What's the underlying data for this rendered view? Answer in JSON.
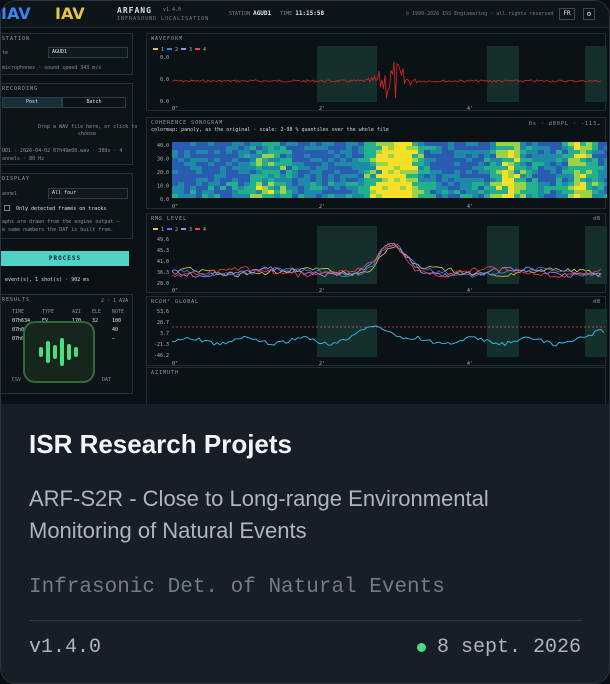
{
  "colors": {
    "accent": "#4fd1c5",
    "status_dot": "#4ade80",
    "card_bg": "#171e27"
  },
  "preview": {
    "logo_left": "IAV",
    "logo_right": "IAV",
    "app_name": "ARFANG",
    "app_version": "v1.4.0",
    "app_subtitle": "INFRASOUND LOCALISATION",
    "station_label": "STATION",
    "station_value": "AGUD1",
    "time_label": "TIME",
    "time_value": "11:15:58",
    "copyright": "© 1999-2026 ISS Engineering · all rights reserved",
    "lang": "FR",
    "left_panel": {
      "station_title": "STATION",
      "site_label": "te",
      "site_value": "AGUD1",
      "site_info": "microphones · sound speed 343 m/s",
      "recording_title": "RECORDING",
      "tab_post": "Post",
      "tab_batch": "Batch",
      "drop_text_1": "Drop a WAV file here, or click to",
      "drop_text_2": "choose",
      "file_info": "UD1 - 2026-04-02 07h49m00.wav · 308s · 4",
      "file_info_2": "annels · 80 Hz",
      "display_title": "DISPLAY",
      "channel_label": "annel",
      "channel_value": "All four",
      "only_detected": "Only detected frames on tracks",
      "display_note_1": "aphs are drawn from the engine output —",
      "display_note_2": "e same numbers the DAT is built from.",
      "process_label": "PROCESS",
      "process_result": "event(s), 1 shot(s) · 902 ms",
      "results_title": "RESULTS",
      "results_count": "2 · 1 AVA",
      "table_headers": [
        "TIME",
        "TYPE",
        "AZI",
        "ELE",
        "NOTE"
      ],
      "table_rows": [
        [
          "07h634",
          "EV",
          "170",
          "32",
          "100"
        ],
        [
          "07h03",
          "",
          "",
          "",
          "40"
        ],
        [
          "07h09",
          "",
          "",
          "",
          "—"
        ]
      ],
      "footer_left": "CSV",
      "footer_right": "DAT"
    },
    "waveform": {
      "title": "WAVEFORM",
      "legend": [
        "1",
        "2",
        "3",
        "4"
      ],
      "yticks": [
        "0.0",
        "0.0",
        "0.0"
      ],
      "xticks": [
        "0\"",
        "2'",
        "4'"
      ]
    },
    "sonogram": {
      "title": "COHERENCE SONOGRAM",
      "subtitle": "colormap: panoly, as the original · scale: 2-98 % quantiles over the whole file",
      "right_info": "0s · dB0PL · -113…",
      "yticks": [
        "40.0",
        "30.0",
        "20.0",
        "10.0",
        "0.0"
      ],
      "xticks": [
        "0\"",
        "2'",
        "4'"
      ]
    },
    "rms": {
      "title": "RMS LEVEL",
      "right_info": "dB",
      "legend": [
        "1",
        "2",
        "3",
        "4"
      ],
      "yticks": [
        "49.6",
        "45.3",
        "41.0",
        "36.3",
        "28.0"
      ],
      "xticks": [
        "0\"",
        "2'",
        "4'"
      ]
    },
    "rcoh": {
      "title": "RCOH² GLOBAL",
      "right_info": "dB",
      "yticks": [
        "53.6",
        "28.7",
        "3.7",
        "-21.3",
        "-46.2"
      ],
      "xticks": [
        "0\"",
        "2'",
        "4'"
      ]
    },
    "azimuth": {
      "title": "AZIMUTH"
    }
  },
  "icon": "waveform-bars-icon",
  "card": {
    "title": "ISR Research Projets",
    "subtitle": "ARF-S2R - Close to Long-range Environmental Monitoring of Natural Events",
    "tagline": "Infrasonic Det. of Natural Events",
    "version": "v1.4.0",
    "date": "8 sept. 2026"
  }
}
